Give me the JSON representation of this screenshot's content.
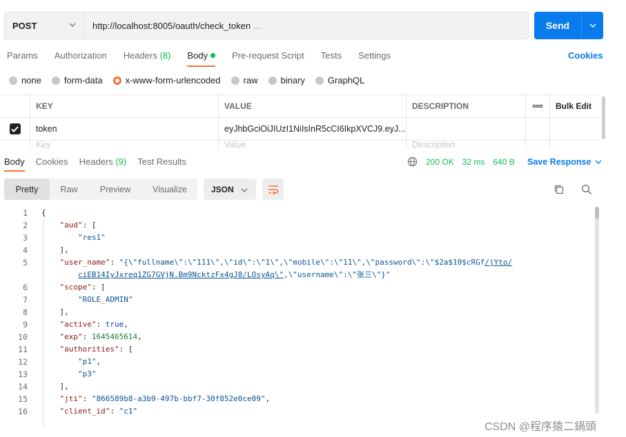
{
  "request": {
    "method": "POST",
    "url": "http://localhost:8005/oauth/check_token",
    "url_ellipsis": "...",
    "send_label": "Send"
  },
  "request_tabs": {
    "params": "Params",
    "authorization": "Authorization",
    "headers": "Headers",
    "headers_count": "(8)",
    "body": "Body",
    "prerequest": "Pre-request Script",
    "tests": "Tests",
    "settings": "Settings",
    "cookies": "Cookies"
  },
  "body_types": {
    "none": "none",
    "form_data": "form-data",
    "urlencoded": "x-www-form-urlencoded",
    "raw": "raw",
    "binary": "binary",
    "graphql": "GraphQL",
    "selected": "x-www-form-urlencoded"
  },
  "params_table": {
    "col_key": "KEY",
    "col_value": "VALUE",
    "col_desc": "DESCRIPTION",
    "more": "ooo",
    "bulk_edit": "Bulk Edit",
    "row_key": "token",
    "row_value": "eyJhbGciOiJIUzI1NiIsInR5cCI6IkpXVCJ9.eyJ...",
    "row_checked": true,
    "ghost_key": "Key",
    "ghost_value": "Value",
    "ghost_desc": "Description"
  },
  "response_tabs": {
    "body": "Body",
    "cookies": "Cookies",
    "headers": "Headers",
    "headers_count": "(9)",
    "test_results": "Test Results"
  },
  "response_meta": {
    "status": "200 OK",
    "time": "32 ms",
    "size": "640 B",
    "save": "Save Response"
  },
  "format_tabs": {
    "pretty": "Pretty",
    "raw": "Raw",
    "preview": "Preview",
    "visualize": "Visualize",
    "format": "JSON"
  },
  "code_lines": {
    "l1": "1",
    "l2": "2",
    "l3": "3",
    "l4": "4",
    "l5": "5",
    "l6": "6",
    "l7": "7",
    "l8": "8",
    "l9": "9",
    "l10": "10",
    "l11": "11",
    "l12": "12",
    "l13": "13",
    "l14": "14",
    "l15": "15",
    "l16": "16"
  },
  "response_json": {
    "aud_key": "\"aud\"",
    "aud_val": "\"res1\"",
    "user_name_key": "\"user_name\"",
    "user_name_part1": "\"{\\\"fullname\\\":\\\"111\\\",\\\"id\\\":\\\"1\\\",\\\"mobile\\\":\\\"11\\\",\\\"password\\\":\\\"$2a$10$cRGf",
    "user_name_link1": "/jYto/",
    "user_name_link2": "ciEB14IyJxreq1ZG7GVjN.Bm9NcktzFx4gJ8/LOsyAq\\\"",
    "user_name_part2": ",\\\"username\\\":\\\"张三\\\"}\"",
    "scope_key": "\"scope\"",
    "scope_val": "\"ROLE_ADMIN\"",
    "active_key": "\"active\"",
    "active_val": "true",
    "exp_key": "\"exp\"",
    "exp_val": "1645465614",
    "authorities_key": "\"authorities\"",
    "auth_val1": "\"p1\"",
    "auth_val2": "\"p3\"",
    "jti_key": "\"jti\"",
    "jti_val": "\"866589b8-a3b9-497b-bbf7-30f852e0ce09\"",
    "client_id_key": "\"client_id\"",
    "client_id_val": "\"c1\""
  },
  "watermark": "CSDN @程序猿二鍋頭",
  "colors": {
    "accent": "#ff6c37",
    "primary": "#097bed",
    "success": "#0cbb52"
  }
}
